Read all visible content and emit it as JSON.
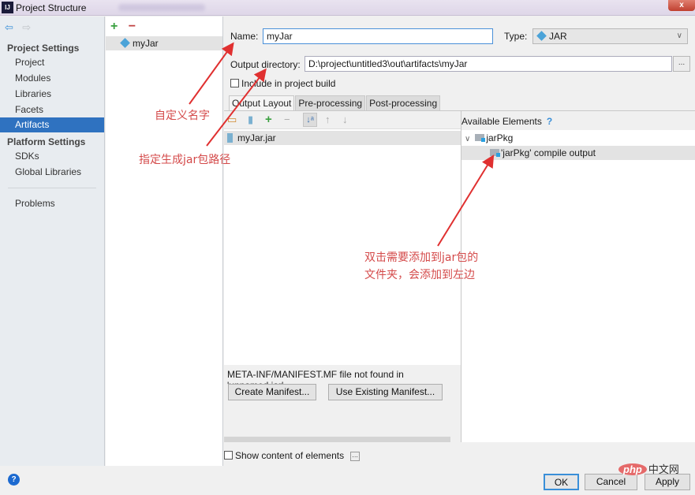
{
  "window": {
    "app_icon": "IJ",
    "title": "Project Structure",
    "close_label": "x"
  },
  "sidebar": {
    "back_icon": "⇦",
    "forward_icon": "⇨",
    "sections": [
      {
        "title": "Project Settings",
        "items": [
          "Project",
          "Modules",
          "Libraries",
          "Facets",
          "Artifacts"
        ]
      },
      {
        "title": "Platform Settings",
        "items": [
          "SDKs",
          "Global Libraries"
        ]
      }
    ],
    "problems": "Problems",
    "active_item": "Artifacts"
  },
  "artifacts": {
    "add_icon": "+",
    "remove_icon": "−",
    "items": [
      "myJar"
    ]
  },
  "form": {
    "name_label": "Name:",
    "name_value": "myJar",
    "type_label": "Type:",
    "type_value": "JAR",
    "output_dir_label": "Output directory:",
    "output_dir_value": "D:\\project\\untitled3\\out\\artifacts\\myJar",
    "browse_label": "...",
    "include_build_label": "Include in project build",
    "include_build_checked": false
  },
  "tabs": [
    {
      "label": "Output Layout",
      "active": true
    },
    {
      "label": "Pre-processing",
      "active": false
    },
    {
      "label": "Post-processing",
      "active": false
    }
  ],
  "layout": {
    "toolbar_icons": [
      "new-folder-icon",
      "archive-icon",
      "add-icon",
      "remove-icon",
      "sort-icon",
      "move-up-icon",
      "move-down-icon"
    ],
    "rows": [
      "myJar.jar"
    ],
    "manifest_message": "META-INF/MANIFEST.MF file not found in 'unnamed.jar'",
    "create_manifest": "Create Manifest...",
    "use_existing_manifest": "Use Existing Manifest..."
  },
  "available": {
    "title": "Available Elements",
    "help": "?",
    "tree": [
      {
        "label": "jarPkg",
        "expanded": true,
        "level": 0
      },
      {
        "label": "'jarPkg' compile output",
        "level": 1,
        "selected": true
      }
    ]
  },
  "show_content_label": "Show content of elements",
  "show_content_checked": false,
  "footer": {
    "help": "?",
    "ok": "OK",
    "cancel": "Cancel",
    "apply": "Apply"
  },
  "annotations": {
    "name_hint": "自定义名字",
    "path_hint": "指定生成jar包路径",
    "add_hint_line1": "双击需要添加到jar包的",
    "add_hint_line2": "文件夹，会添加到左边"
  },
  "watermark": {
    "php": "php",
    "cn": "中文网"
  },
  "colors": {
    "accent": "#2f72c0",
    "annotation": "#d44a4a"
  }
}
